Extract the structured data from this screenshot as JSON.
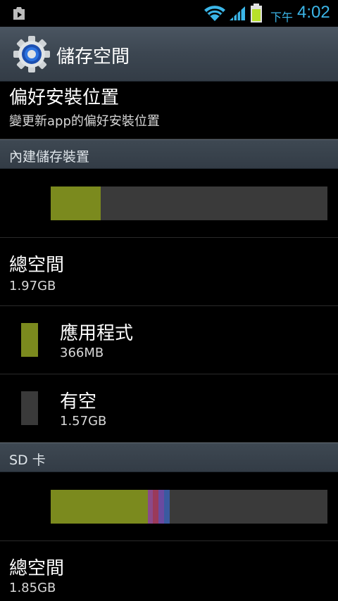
{
  "status_bar": {
    "ampm": "下午",
    "time": "4:02",
    "icons": [
      "play-store-notification-icon",
      "wifi-icon",
      "signal-icon",
      "battery-charging-icon"
    ]
  },
  "action_bar": {
    "title": "儲存空間",
    "icon": "settings-gear-icon"
  },
  "install_location": {
    "title": "偏好安裝位置",
    "subtitle": "變更新app的偏好安裝位置"
  },
  "internal": {
    "header": "內建儲存裝置",
    "bar": {
      "used_fraction": 0.18,
      "colors": {
        "apps": "#7b8a1e",
        "free": "#3a3a3a"
      }
    },
    "total": {
      "title": "總空間",
      "value": "1.97GB"
    },
    "apps": {
      "title": "應用程式",
      "value": "366MB",
      "color": "#7b8a1e"
    },
    "free": {
      "title": "有空",
      "value": "1.57GB",
      "color": "#3a3a3a"
    }
  },
  "sd_card": {
    "header": "SD 卡",
    "bar": {
      "segments": [
        {
          "fraction": 0.35,
          "color": "#7b8a1e"
        },
        {
          "fraction": 0.02,
          "color": "#8a4a8a"
        },
        {
          "fraction": 0.02,
          "color": "#9a3a5a"
        },
        {
          "fraction": 0.02,
          "color": "#6a4aa0"
        },
        {
          "fraction": 0.02,
          "color": "#3a5aa0"
        }
      ],
      "free_color": "#3a3a3a"
    },
    "total": {
      "title": "總空間",
      "value": "1.85GB"
    }
  }
}
